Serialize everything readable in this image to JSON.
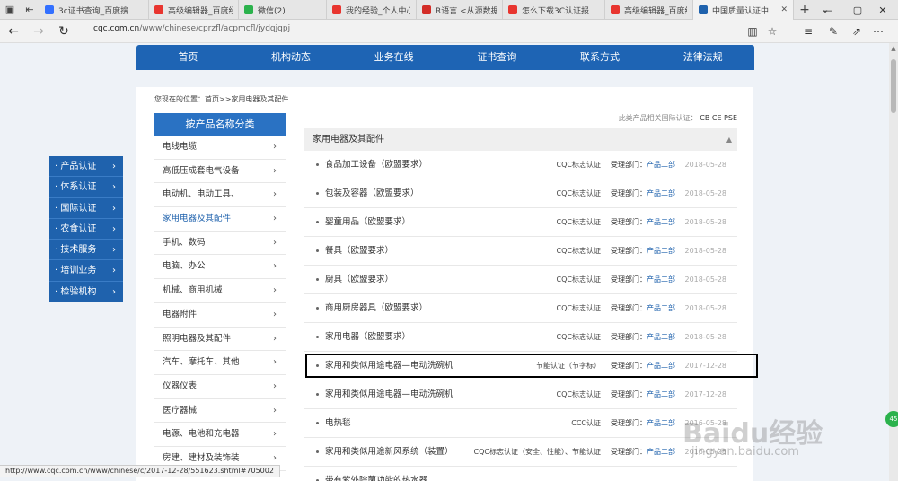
{
  "browser": {
    "tabs": [
      {
        "label": "3c证书查询_百度搜",
        "color": "#3370ff"
      },
      {
        "label": "高级编辑器_百度经",
        "color": "#e8352f"
      },
      {
        "label": "微信(2)",
        "color": "#2bb24c"
      },
      {
        "label": "我的经验_个人中心",
        "color": "#e8352f"
      },
      {
        "label": "R语言 <从源数据选",
        "color": "#d32d27"
      },
      {
        "label": "怎么下载3C认证报",
        "color": "#e8352f"
      },
      {
        "label": "高级编辑器_百度经",
        "color": "#e8352f"
      },
      {
        "label": "中国质量认证中",
        "color": "#1f62ad",
        "active": true
      }
    ],
    "url_host": "cqc.com.cn",
    "url_path": "/www/chinese/cprzfl/acpmcfl/jydqjqpj",
    "status_url": "http://www.cqc.com.cn/www/chinese/c/2017-12-28/551623.shtml#705002"
  },
  "nav": [
    "首页",
    "机构动态",
    "业务在线",
    "证书查询",
    "联系方式",
    "法律法规"
  ],
  "breadcrumb": "您现在的位置：首页>>家用电器及其配件",
  "cert_hint_label": "此类产品相关国际认证：",
  "cert_hint_codes": "CB CE PSE",
  "category_header": "按产品名称分类",
  "categories": [
    "电线电缆",
    "高低压成套电气设备",
    "电动机、电动工具、",
    "家用电器及其配件",
    "手机、数码",
    "电脑、办公",
    "机械、商用机械",
    "电器附件",
    "照明电器及其配件",
    "汽车、摩托车、其他",
    "仪器仪表",
    "医疗器械",
    "电源、电池和充电器",
    "房建、建材及装饰装"
  ],
  "active_category": 3,
  "list_header": "家用电器及其配件",
  "dept_label": "受理部门：",
  "list_rows": [
    {
      "title": "食品加工设备（欧盟要求）",
      "cert": "CQC标志认证",
      "dept": "产品二部",
      "date": "2018-05-28"
    },
    {
      "title": "包装及容器（欧盟要求）",
      "cert": "CQC标志认证",
      "dept": "产品二部",
      "date": "2018-05-28"
    },
    {
      "title": "婴童用品（欧盟要求）",
      "cert": "CQC标志认证",
      "dept": "产品二部",
      "date": "2018-05-28"
    },
    {
      "title": "餐具（欧盟要求）",
      "cert": "CQC标志认证",
      "dept": "产品二部",
      "date": "2018-05-28"
    },
    {
      "title": "厨具（欧盟要求）",
      "cert": "CQC标志认证",
      "dept": "产品二部",
      "date": "2018-05-28"
    },
    {
      "title": "商用厨房器具（欧盟要求）",
      "cert": "CQC标志认证",
      "dept": "产品二部",
      "date": "2018-05-28"
    },
    {
      "title": "家用电器（欧盟要求）",
      "cert": "CQC标志认证",
      "dept": "产品二部",
      "date": "2018-05-28"
    },
    {
      "title": "家用和类似用途电器—电动洗碗机",
      "cert": "节能认证（节字标）",
      "dept": "产品二部",
      "date": "2017-12-28"
    },
    {
      "title": "家用和类似用途电器—电动洗碗机",
      "cert": "CQC标志认证",
      "dept": "产品二部",
      "date": "2017-12-28"
    },
    {
      "title": "电热毯",
      "cert": "CCC认证",
      "dept": "产品二部",
      "date": "2016-05-28"
    },
    {
      "title": "家用和类似用途新风系统（装置）",
      "cert": "CQC标志认证（安全、性能）、节能认证",
      "dept": "产品二部",
      "date": "2016-05-28"
    },
    {
      "title": "带有紫外除菌功能的热水器",
      "cert": "",
      "dept": "",
      "date": ""
    }
  ],
  "side_menu": [
    "产品认证",
    "体系认证",
    "国际认证",
    "农食认证",
    "技术服务",
    "培训业务",
    "检验机构"
  ],
  "watermark": {
    "brand": "Baidu经验",
    "sub": "jingyan.baidu.com"
  },
  "badge_text": "45"
}
